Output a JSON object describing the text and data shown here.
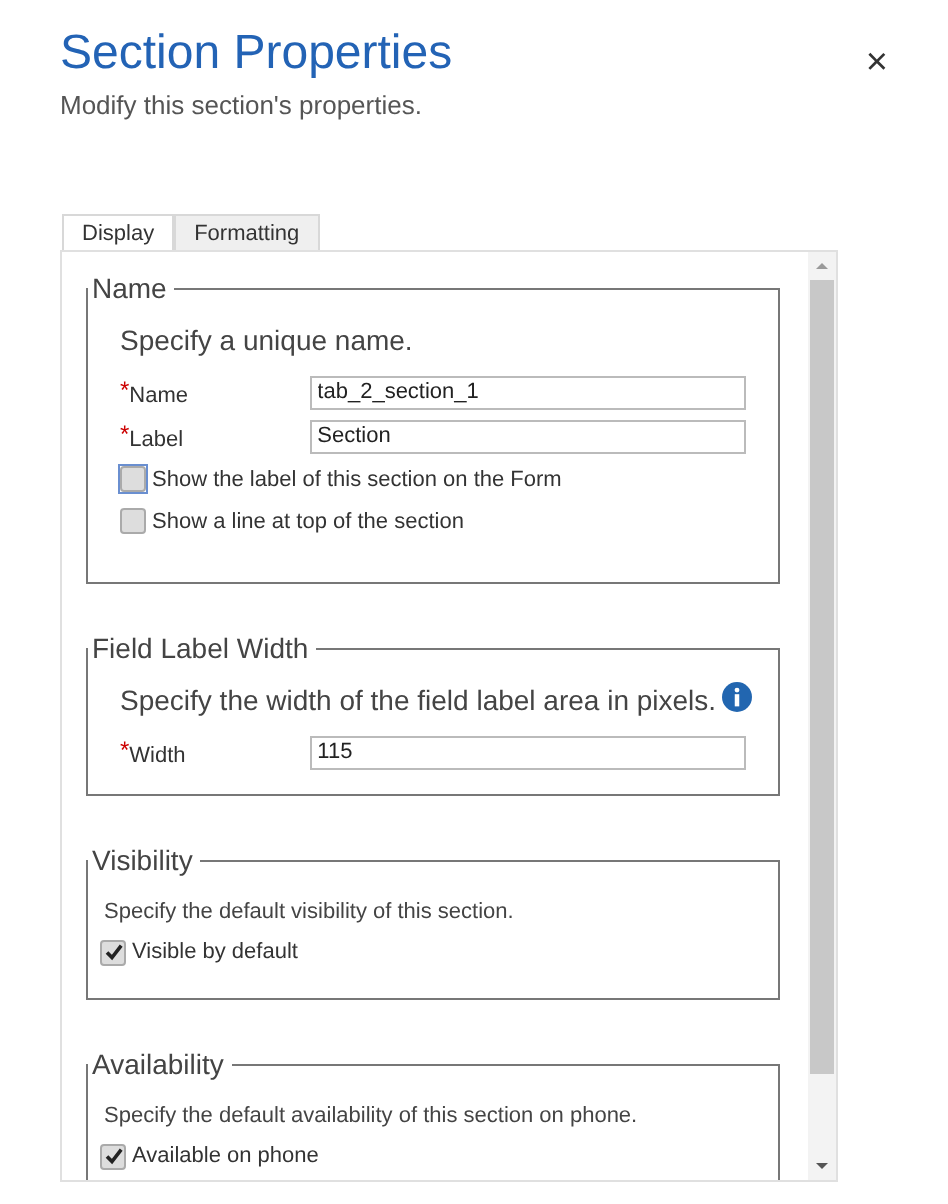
{
  "dialog": {
    "title": "Section Properties",
    "subtitle": "Modify this section's properties.",
    "close": "×"
  },
  "tabs": [
    {
      "label": "Display",
      "selected": true
    },
    {
      "label": "Formatting",
      "selected": false
    }
  ],
  "sections": [
    {
      "kind": "large",
      "legend": "Name",
      "description": "Specify a unique name.",
      "fields": [
        {
          "marker": "*",
          "label": "Name",
          "value": "tab_2_section_1"
        },
        {
          "marker": "*",
          "label": "Label",
          "value": "Section"
        }
      ],
      "checkboxes": [
        {
          "label": "Show the label of this section on the Form",
          "checked": false,
          "focused": true
        },
        {
          "label": "Show a line at top of the section",
          "checked": false,
          "focused": false
        }
      ]
    },
    {
      "kind": "large",
      "legend": "Field Label Width",
      "description": "Specify the width of the field label area in pixels.",
      "info": true,
      "fields": [
        {
          "marker": "*",
          "label": "Width",
          "value": "115"
        }
      ]
    },
    {
      "kind": "compact",
      "legend": "Visibility",
      "description": "Specify the default visibility of this section.",
      "checkboxes": [
        {
          "label": "Visible by default",
          "checked": true,
          "focused": false
        }
      ]
    },
    {
      "kind": "compact",
      "legend": "Availability",
      "description": "Specify the default availability of this section on phone.",
      "checkboxes": [
        {
          "label": "Available on phone",
          "checked": true,
          "focused": false
        }
      ]
    }
  ]
}
